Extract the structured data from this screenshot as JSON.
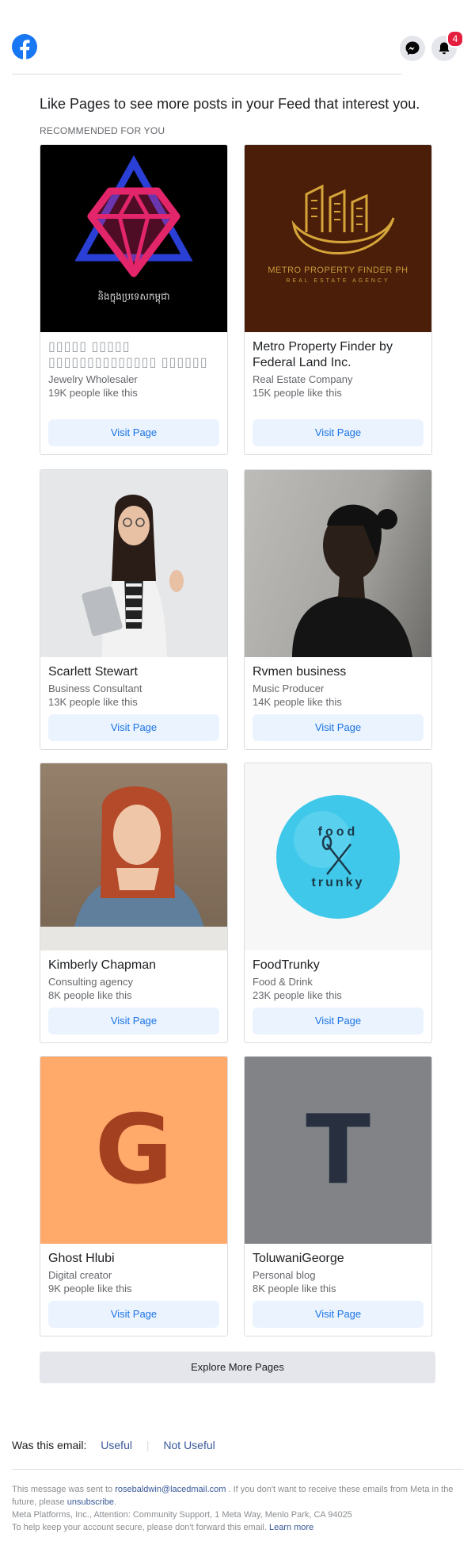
{
  "header": {
    "notification_count": "4",
    "brand_color": "#1877f2"
  },
  "intro_text": "Like Pages to see more posts in your Feed that interest you.",
  "section_label": "RECOMMENDED FOR YOU",
  "cards": [
    {
      "name": "▯▯▯▯▯ ▯▯▯▯▯ ▯▯▯▯▯▯▯▯▯▯▯▯▯▯ ▯▯▯▯▯▯",
      "category": "Jewelry Wholesaler",
      "likes": "19K people like this",
      "button": "Visit Page",
      "image_caption": "និងក្នុងប្រទេសកម្ពុជា"
    },
    {
      "name": "Metro Property Finder by Federal Land Inc.",
      "category": "Real Estate Company",
      "likes": "15K people like this",
      "button": "Visit Page",
      "logo_title": "METRO PROPERTY FINDER PH",
      "logo_subtitle": "REAL ESTATE AGENCY"
    },
    {
      "name": "Scarlett Stewart",
      "category": "Business Consultant",
      "likes": "13K people like this",
      "button": "Visit Page"
    },
    {
      "name": "Rvmen business",
      "category": "Music Producer",
      "likes": "14K people like this",
      "button": "Visit Page"
    },
    {
      "name": "Kimberly Chapman",
      "category": "Consulting agency",
      "likes": "8K people like this",
      "button": "Visit Page"
    },
    {
      "name": "FoodTrunky",
      "category": "Food & Drink",
      "likes": "23K people like this",
      "button": "Visit Page",
      "logo_word1": "food",
      "logo_word2": "trunky"
    },
    {
      "name": "Ghost Hlubi",
      "category": "Digital creator",
      "likes": "9K people like this",
      "button": "Visit Page",
      "initial": "G"
    },
    {
      "name": "ToluwaniGeorge",
      "category": "Personal blog",
      "likes": "8K people like this",
      "button": "Visit Page",
      "initial": "T"
    }
  ],
  "explore_button": "Explore More Pages",
  "feedback": {
    "question": "Was this email:",
    "useful": "Useful",
    "separator": "|",
    "not_useful": "Not Useful"
  },
  "footer": {
    "line1_prefix": "This message was sent to",
    "email": "rosebaldwin@lacedmail.com",
    "line1_suffix": ". If you don't want to receive these emails from Meta in the future, please",
    "unsubscribe": "unsubscribe",
    "period": ".",
    "line2": "Meta Platforms, Inc., Attention: Community Support, 1 Meta Way, Menlo Park, CA 94025",
    "line3_prefix": "To help keep your account secure, please don't forward this email.",
    "learn_more": "Learn more"
  }
}
